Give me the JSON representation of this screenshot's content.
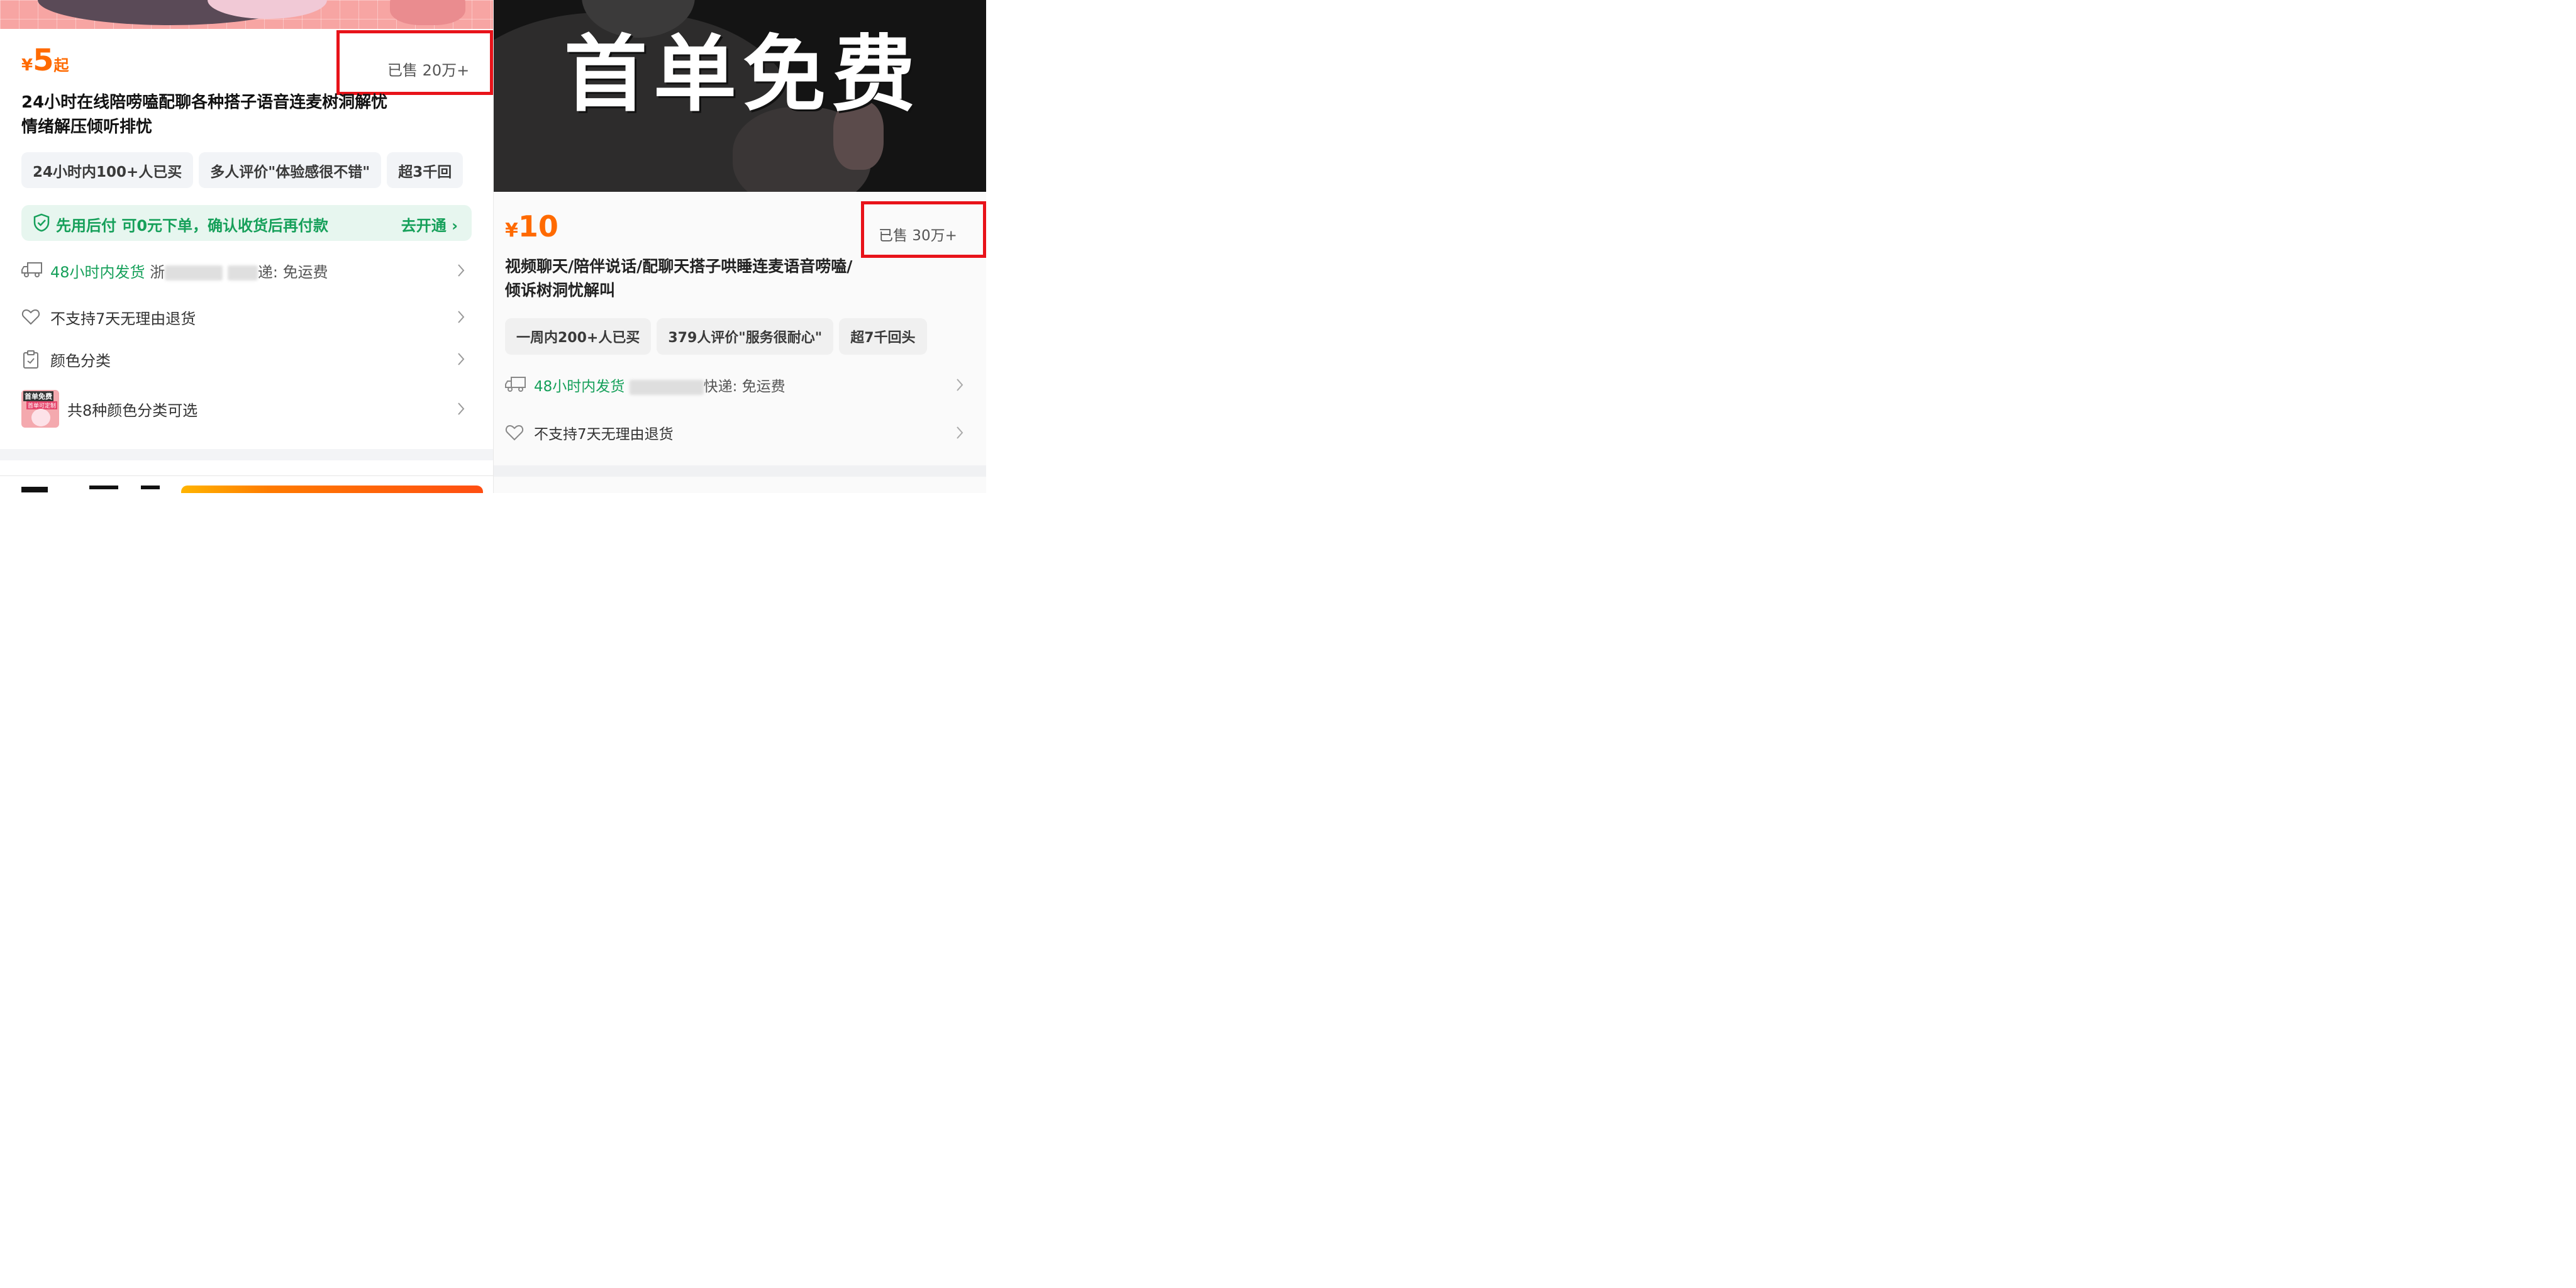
{
  "left": {
    "price": {
      "currency": "¥",
      "amount": "5",
      "suffix": "起"
    },
    "sold": "已售 20万+",
    "title_lines": [
      "24小时在线陪唠嗑配聊各种搭子语音连麦树洞解忧",
      "情绪解压倾听排忧"
    ],
    "tags": [
      "24小时内100+人已买",
      "多人评价\"体验感很不错\"",
      "超3千回"
    ],
    "pay_later": {
      "text": "先用后付 可0元下单，确认收货后再付款",
      "action": "去开通",
      "icon": "shield-check-icon"
    },
    "shipping": {
      "time": "48小时内发货",
      "partial": "浙",
      "express_suffix": "递:",
      "fee": "免运费",
      "icon": "truck-icon"
    },
    "return_policy": {
      "text": "不支持7天无理由退货",
      "icon": "heart-outline-icon"
    },
    "color_category": {
      "text": "颜色分类",
      "icon": "clipboard-icon"
    },
    "variants": {
      "text": "共8种颜色分类可选",
      "thumb_badge": "首单免费",
      "thumb_sub": "首单可定制"
    },
    "colors": {
      "price": "#ff6a00",
      "green": "#16a05a",
      "highlight": "#e8131a"
    }
  },
  "right": {
    "hero_text": "首单免费",
    "price": {
      "currency": "¥",
      "amount": "10"
    },
    "sold": "已售 30万+",
    "title_lines": [
      "视频聊天/陪伴说话/配聊天搭子哄睡连麦语音唠嗑/",
      "倾诉树洞忧解叫"
    ],
    "tags": [
      "一周内200+人已买",
      "379人评价\"服务很耐心\"",
      "超7千回头"
    ],
    "shipping": {
      "time": "48小时内发货",
      "express": "快递:",
      "fee": "免运费",
      "icon": "truck-icon"
    },
    "return_policy": {
      "text": "不支持7天无理由退货",
      "icon": "heart-outline-icon"
    }
  }
}
